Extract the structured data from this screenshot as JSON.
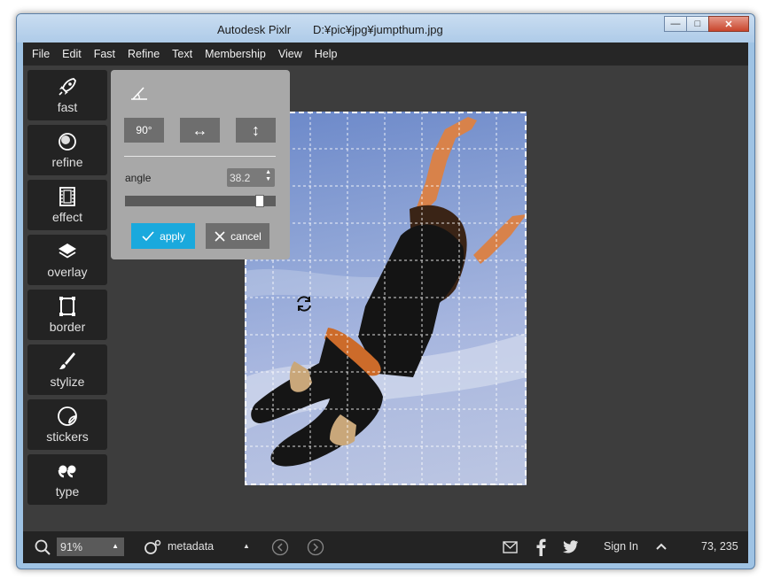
{
  "window": {
    "app_title": "Autodesk Pixlr",
    "file_path": "D:¥pic¥jpg¥jumpthum.jpg",
    "minimize_label": "—",
    "maximize_label": "□",
    "close_label": "✕"
  },
  "menu": [
    "File",
    "Edit",
    "Fast",
    "Refine",
    "Text",
    "Membership",
    "View",
    "Help"
  ],
  "tools": [
    {
      "label": "fast",
      "icon": "rocket-icon"
    },
    {
      "label": "refine",
      "icon": "refine-icon"
    },
    {
      "label": "effect",
      "icon": "film-icon"
    },
    {
      "label": "overlay",
      "icon": "layers-icon"
    },
    {
      "label": "border",
      "icon": "border-icon"
    },
    {
      "label": "stylize",
      "icon": "brush-icon"
    },
    {
      "label": "stickers",
      "icon": "sticker-icon"
    },
    {
      "label": "type",
      "icon": "quote-icon"
    }
  ],
  "rotate_panel": {
    "rotate90_label": "90°",
    "flip_h_label": "↔",
    "flip_v_label": "↕",
    "angle_label": "angle",
    "angle_value": "38.2",
    "slider_level": 0.92,
    "apply_label": "apply",
    "cancel_label": "cancel",
    "apply_color": "#1aa9dd"
  },
  "status": {
    "zoom": "91%",
    "metadata_label": "metadata",
    "sign_in_label": "Sign In",
    "coords": "73, 235"
  }
}
